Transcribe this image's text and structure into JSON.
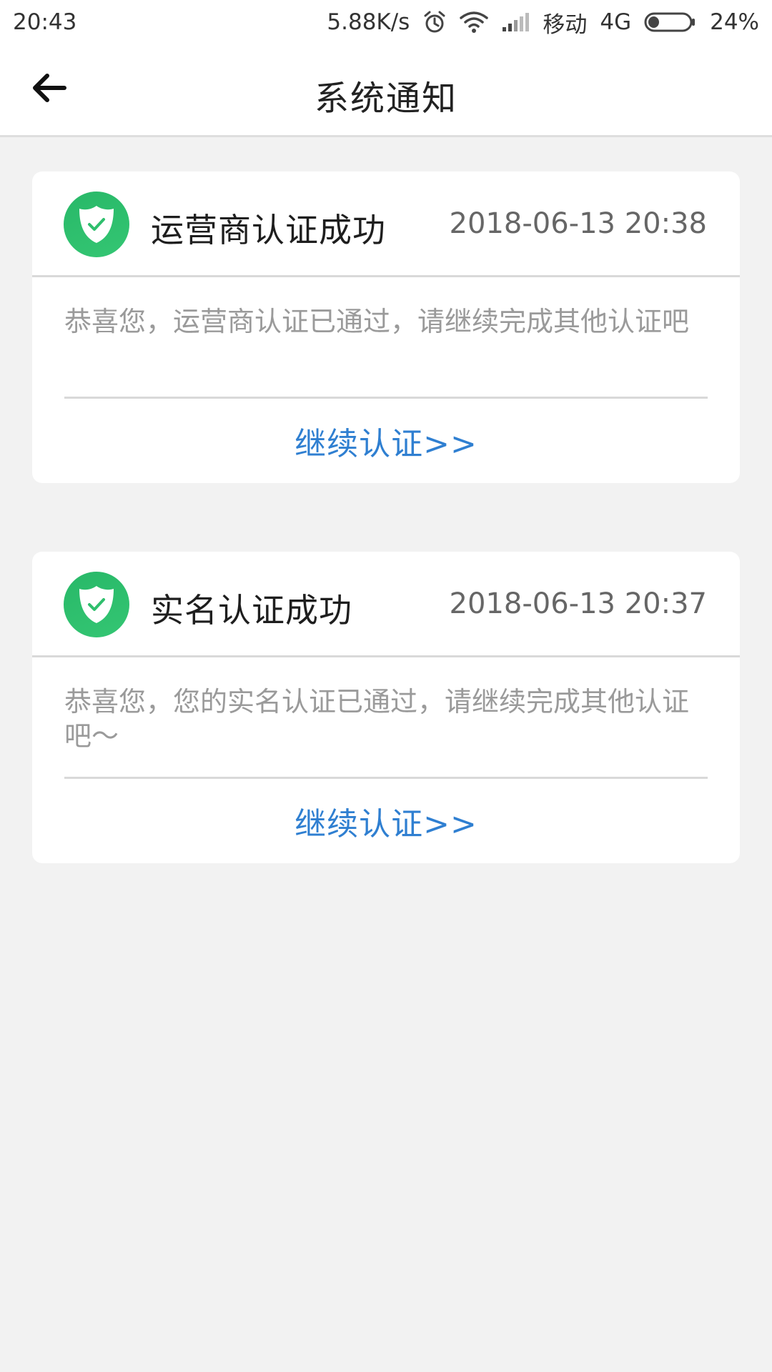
{
  "status_bar": {
    "time": "20:43",
    "net_speed": "5.88K/s",
    "carrier": "移动",
    "network": "4G",
    "battery": "24%",
    "battery_level": 0.24
  },
  "header": {
    "title": "系统通知"
  },
  "notifications": [
    {
      "title": "运营商认证成功",
      "time": "2018-06-13 20:38",
      "message": "恭喜您，运营商认证已通过，请继续完成其他认证吧",
      "action": "继续认证>>"
    },
    {
      "title": "实名认证成功",
      "time": "2018-06-13 20:37",
      "message": "恭喜您，您的实名认证已通过，请继续完成其他认证吧～",
      "action": "继续认证>>"
    }
  ],
  "colors": {
    "accent_blue": "#2f7fd1",
    "success_green": "#2fbf6d",
    "background": "#f2f2f2"
  },
  "icons": {
    "back": "arrow-left-icon",
    "notification": "shield-check-icon",
    "alarm": "alarm-icon",
    "wifi": "wifi-icon",
    "signal": "signal-icon",
    "battery": "battery-icon"
  }
}
